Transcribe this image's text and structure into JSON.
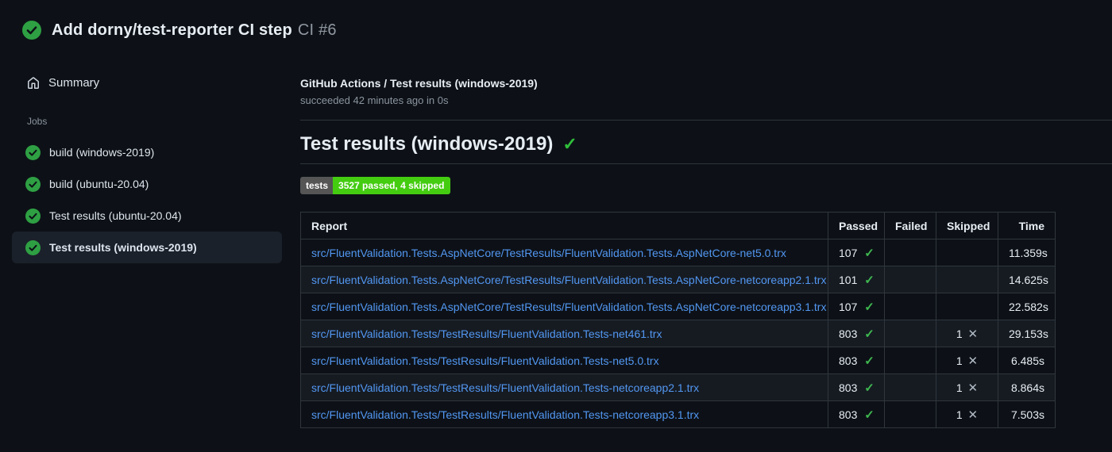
{
  "header": {
    "title": "Add dorny/test-reporter CI step",
    "run_number": "CI #6"
  },
  "sidebar": {
    "summary_label": "Summary",
    "jobs_label": "Jobs",
    "jobs": [
      {
        "label": "build (windows-2019)",
        "selected": false
      },
      {
        "label": "build (ubuntu-20.04)",
        "selected": false
      },
      {
        "label": "Test results (ubuntu-20.04)",
        "selected": false
      },
      {
        "label": "Test results (windows-2019)",
        "selected": true
      }
    ]
  },
  "main": {
    "run_title": "GitHub Actions / Test results (windows-2019)",
    "run_status": "succeeded 42 minutes ago in 0s",
    "section_heading": "Test results (windows-2019)",
    "heading_check_icon": "✓",
    "badge": {
      "label": "tests",
      "value": "3527 passed, 4 skipped",
      "label_bg": "#555555",
      "value_bg": "#44cc11"
    },
    "table": {
      "columns": [
        "Report",
        "Passed",
        "Failed",
        "Skipped",
        "Time"
      ],
      "rows": [
        {
          "report": "src/FluentValidation.Tests.AspNetCore/TestResults/FluentValidation.Tests.AspNetCore-net5.0.trx",
          "passed": "107",
          "failed": "",
          "skipped": "",
          "time": "11.359s"
        },
        {
          "report": "src/FluentValidation.Tests.AspNetCore/TestResults/FluentValidation.Tests.AspNetCore-netcoreapp2.1.trx",
          "passed": "101",
          "failed": "",
          "skipped": "",
          "time": "14.625s"
        },
        {
          "report": "src/FluentValidation.Tests.AspNetCore/TestResults/FluentValidation.Tests.AspNetCore-netcoreapp3.1.trx",
          "passed": "107",
          "failed": "",
          "skipped": "",
          "time": "22.582s"
        },
        {
          "report": "src/FluentValidation.Tests/TestResults/FluentValidation.Tests-net461.trx",
          "passed": "803",
          "failed": "",
          "skipped": "1",
          "time": "29.153s"
        },
        {
          "report": "src/FluentValidation.Tests/TestResults/FluentValidation.Tests-net5.0.trx",
          "passed": "803",
          "failed": "",
          "skipped": "1",
          "time": "6.485s"
        },
        {
          "report": "src/FluentValidation.Tests/TestResults/FluentValidation.Tests-netcoreapp2.1.trx",
          "passed": "803",
          "failed": "",
          "skipped": "1",
          "time": "8.864s"
        },
        {
          "report": "src/FluentValidation.Tests/TestResults/FluentValidation.Tests-netcoreapp3.1.trx",
          "passed": "803",
          "failed": "",
          "skipped": "1",
          "time": "7.503s"
        }
      ]
    }
  },
  "colors": {
    "page_bg": "#0d1117",
    "success_green": "#2ea043",
    "check_green": "#3fb950",
    "link_blue": "#5297f2",
    "muted_text": "#8b949e",
    "table_border": "#30363d",
    "row_alt_bg": "#161b22",
    "selected_item_bg": "#1b212b"
  },
  "glyphs": {
    "check": "✓",
    "cross": "✕"
  }
}
